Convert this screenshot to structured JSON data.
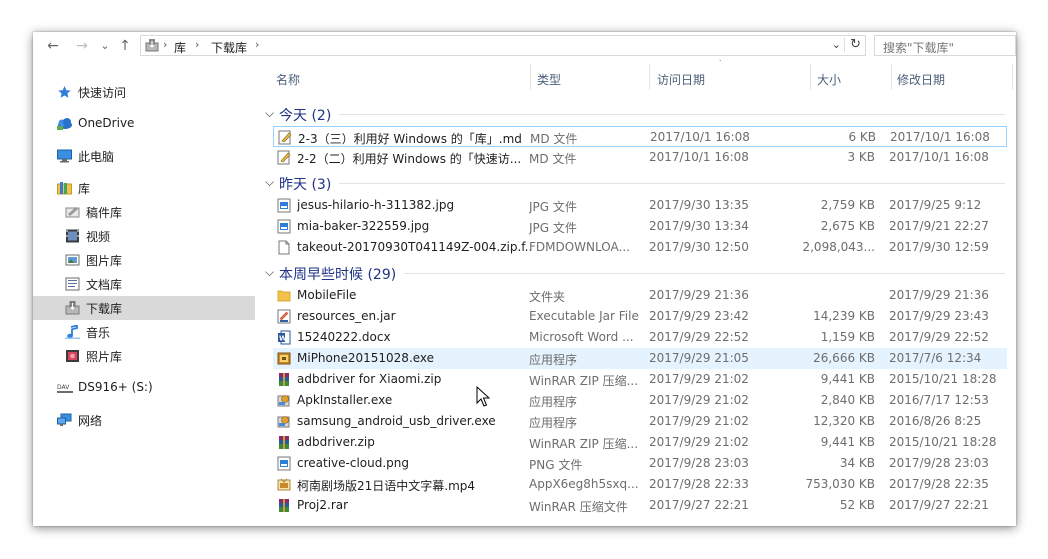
{
  "nav": {
    "back": "←",
    "forward": "→",
    "recent": "⌄",
    "up": "↑",
    "breadcrumbs": [
      "库",
      "下载库"
    ],
    "separator": "›",
    "dropdown": "⌄",
    "refresh": "↻",
    "search_placeholder": "搜索\"下载库\""
  },
  "sidebar": {
    "items": [
      {
        "label": "快速访问",
        "icon": "star-icon"
      },
      {
        "label": "OneDrive",
        "icon": "cloud-icon"
      },
      {
        "label": "此电脑",
        "icon": "computer-icon"
      },
      {
        "label": "库",
        "icon": "library-icon"
      },
      {
        "label": "稿件库",
        "icon": "drafts-library-icon"
      },
      {
        "label": "视频",
        "icon": "video-icon"
      },
      {
        "label": "图片库",
        "icon": "picture-icon"
      },
      {
        "label": "文档库",
        "icon": "document-icon"
      },
      {
        "label": "下载库",
        "icon": "download-icon",
        "selected": true
      },
      {
        "label": "音乐",
        "icon": "music-icon"
      },
      {
        "label": "照片库",
        "icon": "photo-icon"
      },
      {
        "label": "DS916+ (S:)",
        "icon": "network-drive-icon"
      },
      {
        "label": "网络",
        "icon": "network-icon"
      }
    ]
  },
  "columns": {
    "name": "名称",
    "type": "类型",
    "accessed": "访问日期",
    "size": "大小",
    "modified": "修改日期",
    "sort_indicator": "˅"
  },
  "groups": [
    {
      "title": "今天 (2)",
      "rows": [
        {
          "name": "2-3（三）利用好 Windows 的「库」.md",
          "type": "MD 文件",
          "accessed": "2017/10/1 16:08",
          "size": "6 KB",
          "modified": "2017/10/1 16:08",
          "icon": "markdown-file-icon",
          "focused": true
        },
        {
          "name": "2-2（二）利用好 Windows 的「快速访...",
          "type": "MD 文件",
          "accessed": "2017/10/1 16:08",
          "size": "3 KB",
          "modified": "2017/10/1 16:08",
          "icon": "markdown-file-icon"
        }
      ]
    },
    {
      "title": "昨天 (3)",
      "rows": [
        {
          "name": "jesus-hilario-h-311382.jpg",
          "type": "JPG 文件",
          "accessed": "2017/9/30 13:35",
          "size": "2,759 KB",
          "modified": "2017/9/25 9:12",
          "icon": "image-file-icon"
        },
        {
          "name": "mia-baker-322559.jpg",
          "type": "JPG 文件",
          "accessed": "2017/9/30 13:34",
          "size": "2,675 KB",
          "modified": "2017/9/21 22:27",
          "icon": "image-file-icon"
        },
        {
          "name": "takeout-20170930T041149Z-004.zip.f...",
          "type": "FDMDOWNLOA...",
          "accessed": "2017/9/30 12:50",
          "size": "2,098,043...",
          "modified": "2017/9/30 12:59",
          "icon": "blank-file-icon"
        }
      ]
    },
    {
      "title": "本周早些时候 (29)",
      "rows": [
        {
          "name": "MobileFile",
          "type": "文件夹",
          "accessed": "2017/9/29 21:36",
          "size": "",
          "modified": "2017/9/29 21:36",
          "icon": "folder-icon"
        },
        {
          "name": "resources_en.jar",
          "type": "Executable Jar File",
          "accessed": "2017/9/29 23:42",
          "size": "14,239 KB",
          "modified": "2017/9/29 23:43",
          "icon": "jar-file-icon"
        },
        {
          "name": "15240222.docx",
          "type": "Microsoft Word ...",
          "accessed": "2017/9/29 22:52",
          "size": "1,159 KB",
          "modified": "2017/9/29 22:52",
          "icon": "word-file-icon"
        },
        {
          "name": "MiPhone20151028.exe",
          "type": "应用程序",
          "accessed": "2017/9/29 21:05",
          "size": "26,666 KB",
          "modified": "2017/7/6 12:34",
          "icon": "exe-file-icon",
          "hover": true
        },
        {
          "name": "adbdriver for Xiaomi.zip",
          "type": "WinRAR ZIP 压缩...",
          "accessed": "2017/9/29 21:02",
          "size": "9,441 KB",
          "modified": "2015/10/21 18:28",
          "icon": "winrar-file-icon"
        },
        {
          "name": "ApkInstaller.exe",
          "type": "应用程序",
          "accessed": "2017/9/29 21:02",
          "size": "2,840 KB",
          "modified": "2016/7/17 12:53",
          "icon": "installer-icon"
        },
        {
          "name": "samsung_android_usb_driver.exe",
          "type": "应用程序",
          "accessed": "2017/9/29 21:02",
          "size": "12,320 KB",
          "modified": "2016/8/26 8:25",
          "icon": "installer-icon"
        },
        {
          "name": "adbdriver.zip",
          "type": "WinRAR ZIP 压缩...",
          "accessed": "2017/9/29 21:02",
          "size": "9,441 KB",
          "modified": "2015/10/21 18:28",
          "icon": "winrar-file-icon"
        },
        {
          "name": "creative-cloud.png",
          "type": "PNG 文件",
          "accessed": "2017/9/28 23:03",
          "size": "34 KB",
          "modified": "2017/9/28 23:03",
          "icon": "image-file-icon"
        },
        {
          "name": "柯南剧场版21日语中文字幕.mp4",
          "type": "AppX6eg8h5sxq...",
          "accessed": "2017/9/28 22:33",
          "size": "753,030 KB",
          "modified": "2017/9/28 22:35",
          "icon": "video-file-icon"
        },
        {
          "name": "Proj2.rar",
          "type": "WinRAR 压缩文件",
          "accessed": "2017/9/27 22:21",
          "size": "52 KB",
          "modified": "2017/9/27 22:21",
          "icon": "winrar-file-icon"
        }
      ]
    }
  ],
  "colors": {
    "group_title": "#1e3287",
    "selected_nav": "#d9d9d9",
    "hover_row": "#e5f3ff",
    "focus_border": "#99d1ff"
  }
}
